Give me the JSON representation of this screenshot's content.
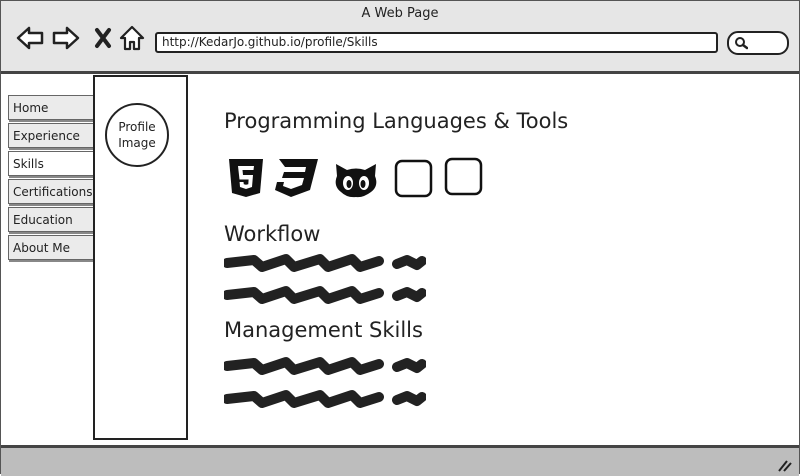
{
  "window": {
    "title": "A Web Page"
  },
  "toolbar": {
    "back_icon": "arrow-left-icon",
    "forward_icon": "arrow-right-icon",
    "close_icon": "close-icon",
    "home_icon": "home-icon",
    "url": "http://KedarJo.github.io/profile/Skills",
    "search_icon": "search-icon"
  },
  "sidebar": {
    "items": [
      {
        "label": "Home"
      },
      {
        "label": "Experience"
      },
      {
        "label": "Skills",
        "selected": true
      },
      {
        "label": "Certifications"
      },
      {
        "label": "Education"
      },
      {
        "label": "About Me"
      }
    ]
  },
  "profile": {
    "image_label": "Profile Image"
  },
  "main": {
    "languages_heading": "Programming Languages & Tools",
    "tool_icons": [
      "html5-icon",
      "css3-icon",
      "github-icon",
      "placeholder-icon",
      "placeholder-icon"
    ],
    "workflow_heading": "Workflow",
    "management_heading": "Management Skills"
  },
  "colors": {
    "chrome": "#e6e6e6",
    "statusbar": "#bdbdbd",
    "ink": "#222222"
  }
}
